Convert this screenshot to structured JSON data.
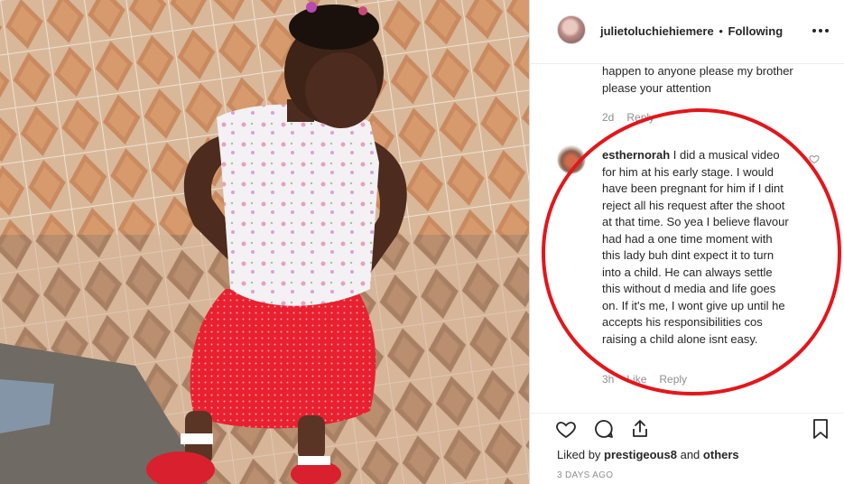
{
  "post": {
    "username": "julietoluchiehiemere",
    "follow_status": "Following",
    "photo_icon": "photo-of-toddler-in-red-skirt"
  },
  "comments": [
    {
      "text_tail": "happen to anyone please my brother please your attention",
      "time": "2d",
      "reply_label": "Reply"
    },
    {
      "username": "esthernorah",
      "text": "I did a musical video for him at his early stage. I would have been pregnant for him if I dint reject all his request after the shoot at that time. So yea I believe flavour had had a one time moment with this lady buh dint expect it to turn into a child. He can always settle this without d media and life goes on. If it's me, I wont give up until he accepts his responsibilities cos raising a child alone isnt easy.",
      "time": "3h",
      "like_label": "Like",
      "reply_label": "Reply"
    }
  ],
  "actions": {
    "liked_prefix": "Liked by",
    "liked_user": "prestigeous8",
    "liked_and": "and",
    "liked_others": "others",
    "date": "3 DAYS AGO"
  },
  "colors": {
    "annotation_circle": "#e3161b",
    "text": "#262626",
    "muted": "#8e8e8e"
  }
}
